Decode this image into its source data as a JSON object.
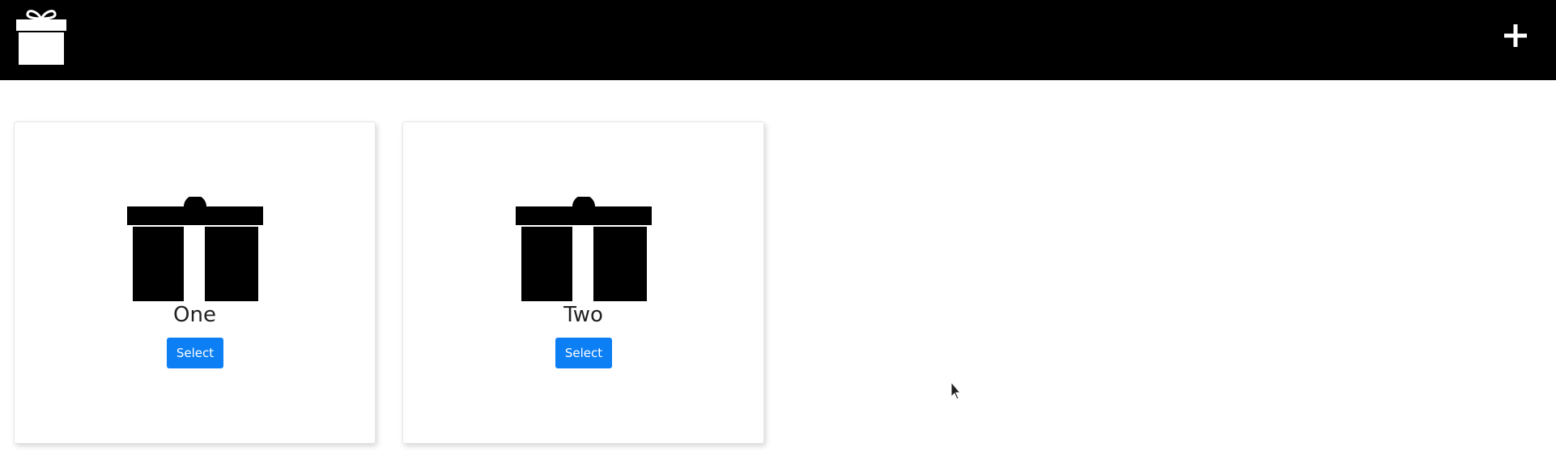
{
  "header": {
    "logo_icon": "gift-icon",
    "add_icon": "plus-icon",
    "background_color": "#000000"
  },
  "cards": [
    {
      "name": "One",
      "button_label": "Select",
      "icon": "gift-icon"
    },
    {
      "name": "Two",
      "button_label": "Select",
      "icon": "gift-icon"
    }
  ],
  "colors": {
    "button_blue": "#0d7ff5"
  }
}
